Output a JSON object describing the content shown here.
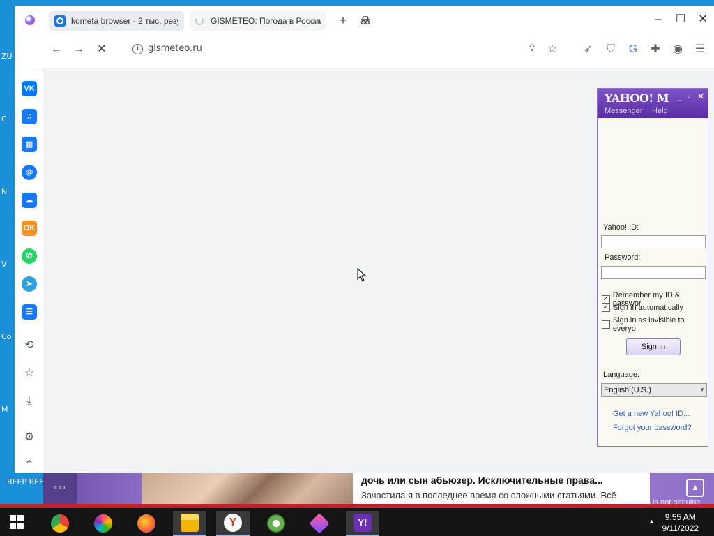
{
  "desktop": {
    "labels": [
      "ZU",
      "C",
      "N",
      "V",
      "Co",
      "M",
      "BEEP BEEP"
    ]
  },
  "browser": {
    "tabs": [
      {
        "title": "kometa browser - 2 тыс. резу",
        "active": false
      },
      {
        "title": "GISMETEO: Погода в России",
        "active": true
      }
    ],
    "url": "gismeteo.ru"
  },
  "sidebar": {
    "apps": [
      {
        "name": "vk",
        "glyph": "VK",
        "color": "#0077ff"
      },
      {
        "name": "music",
        "glyph": "♫",
        "color": "#1677ff"
      },
      {
        "name": "stats",
        "glyph": "▥",
        "color": "#1677ff"
      },
      {
        "name": "mail",
        "glyph": "@",
        "color": "#1677ff"
      },
      {
        "name": "cloud",
        "glyph": "☁",
        "color": "#ff7a2e"
      },
      {
        "name": "ok",
        "glyph": "OK",
        "color": "#f7931e"
      },
      {
        "name": "whatsapp",
        "glyph": "✆",
        "color": "#25d366"
      },
      {
        "name": "telegram",
        "glyph": "➤",
        "color": "#2aa3df"
      },
      {
        "name": "list",
        "glyph": "☰",
        "color": "#1677ff"
      }
    ]
  },
  "yahoo": {
    "logo": "YAHOO! M",
    "menu": [
      "Messenger",
      "Help"
    ],
    "id_label": "Yahoo! ID:",
    "password_label": "Password:",
    "checks": [
      {
        "label": "Remember my ID & passwor",
        "checked": true
      },
      {
        "label": "Sign in automatically",
        "checked": true
      },
      {
        "label": "Sign in as invisible to everyo",
        "checked": false
      }
    ],
    "signin": "Sign In",
    "language_label": "Language:",
    "language_value": "English (U.S.)",
    "links": [
      "Get a new Yahoo! ID...",
      "Forgot your password?"
    ]
  },
  "banner": {
    "dots": "◦◦◦",
    "title": "дочь или сын абьюзер. Исключительные права...",
    "subtitle": "Зачастила я в последнее время со сложными статьями. Всё"
  },
  "watermark": "This copy of Windows is not genuine",
  "taskbar": {
    "time": "9:55 AM",
    "date": "9/11/2022"
  }
}
